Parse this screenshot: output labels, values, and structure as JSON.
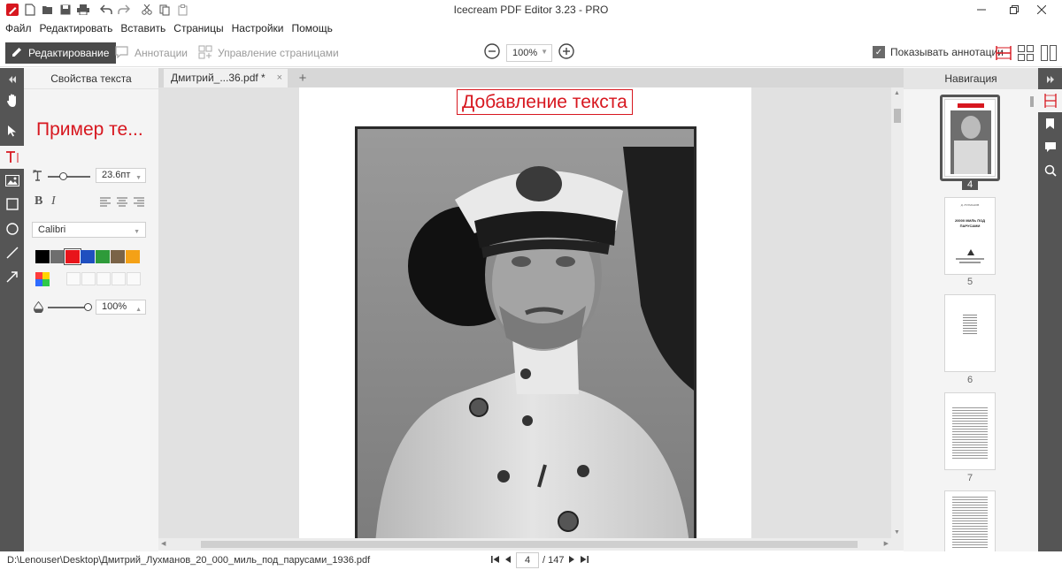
{
  "window": {
    "title": "Icecream PDF Editor 3.23 - PRO"
  },
  "quick_access": [
    "app-logo-icon",
    "new-file-icon",
    "open-file-icon",
    "save-icon",
    "print-icon",
    "undo-icon",
    "redo-icon",
    "cut-icon",
    "copy-icon",
    "paste-icon"
  ],
  "menu": {
    "file": "Файл",
    "edit": "Редактировать",
    "insert": "Вставить",
    "pages": "Страницы",
    "settings": "Настройки",
    "help": "Помощь"
  },
  "toolbar": {
    "edit_mode": "Редактирование",
    "annotations_mode": "Аннотации",
    "pages_mode": "Управление страницами",
    "zoom": "100%",
    "show_annotations": "Показывать аннотации",
    "show_annotations_checked": true
  },
  "text_props": {
    "header": "Свойства текста",
    "sample": "Пример те...",
    "font_size": "23.6пт",
    "font": "Calibri",
    "opacity": "100%",
    "opacity_level": 1.0,
    "colors": [
      "#000000",
      "#6e6e6e",
      "#e8141b",
      "#1f4fbf",
      "#2e9b3a",
      "#7a6347",
      "#f4a116"
    ]
  },
  "tab": {
    "name": "Дмитрий_...36.pdf *",
    "close": "×",
    "new": "+"
  },
  "document": {
    "added_text": "Добавление текста"
  },
  "navigation": {
    "header": "Навигация",
    "page_4": "4",
    "page_5": "5",
    "page_6": "6",
    "page_7": "7",
    "thumb5_title": "20000 МИЛЬ ПОД ПАРУСАМИ",
    "thumb5_author": "Д. ЛУХМАНОВ"
  },
  "status": {
    "path": "D:\\Lenouser\\Desktop\\Дмитрий_Лухманов_20_000_миль_под_парусами_1936.pdf",
    "current_page": "4",
    "total_pages": "/ 147"
  },
  "colors": {
    "accent_red": "#d7171f",
    "dark_panel": "#555555",
    "panel_bg": "#f4f4f4"
  }
}
